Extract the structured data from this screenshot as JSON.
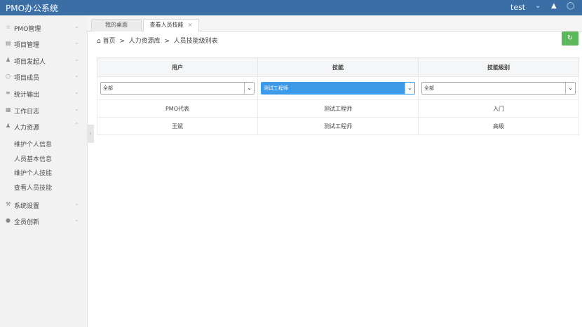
{
  "app": {
    "title": "PMO办公系统"
  },
  "topbar": {
    "user": "test",
    "icons": [
      "chevron-down-icon",
      "shirt-icon",
      "power-icon"
    ]
  },
  "sidebar": {
    "items": [
      {
        "label": "PMO管理",
        "icon": "star-icon"
      },
      {
        "label": "项目管理",
        "icon": "folder-icon"
      },
      {
        "label": "项目发起人",
        "icon": "person-icon"
      },
      {
        "label": "项目成员",
        "icon": "group-icon"
      },
      {
        "label": "统计输出",
        "icon": "chart-icon"
      },
      {
        "label": "工作日志",
        "icon": "log-icon"
      },
      {
        "label": "人力资源",
        "icon": "people-icon"
      }
    ],
    "subitems": [
      "维护个人信息",
      "人员基本信息",
      "维护个人技能",
      "查看人员技能"
    ],
    "bottom_items": [
      {
        "label": "系统设置",
        "icon": "wrench-icon"
      },
      {
        "label": "全员创新",
        "icon": "bulb-icon"
      }
    ]
  },
  "tabs": [
    {
      "label": "我的桌面"
    },
    {
      "label": "查看人员技能",
      "close": "×"
    }
  ],
  "breadcrumb": {
    "home": "首页",
    "sep": ">",
    "level1": "人力资源库",
    "level2": "人员技能级别表"
  },
  "table": {
    "headers": [
      "用户",
      "技能",
      "技能级别"
    ],
    "filters": [
      "全部",
      "测试工程师",
      "全部"
    ],
    "rows": [
      [
        "PMO代表",
        "测试工程师",
        "入门"
      ],
      [
        "王斌",
        "测试工程师",
        "高级"
      ]
    ]
  },
  "colors": {
    "topbar": "#3a6ea5",
    "accent_select": "#3d9ae8",
    "action_button": "#5cb85c"
  }
}
